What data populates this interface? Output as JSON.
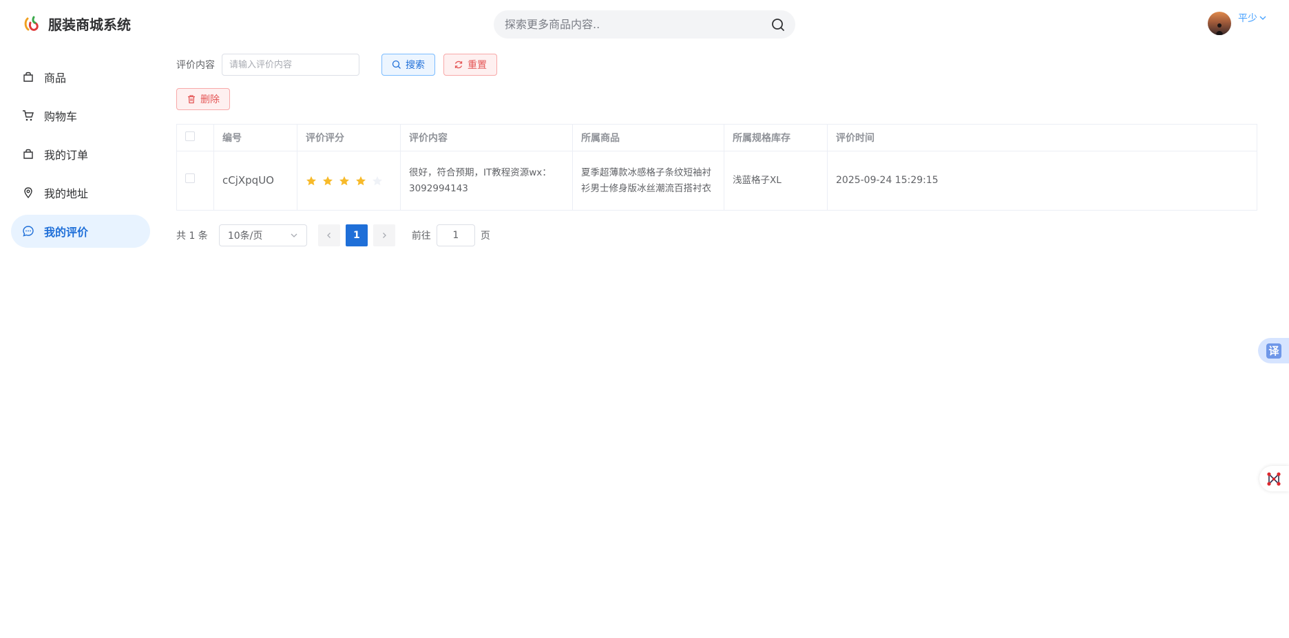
{
  "app": {
    "title": "服装商城系统"
  },
  "header": {
    "search": {
      "placeholder": "探索更多商品内容.."
    },
    "user": {
      "name": "平少"
    }
  },
  "sidebar": {
    "items": [
      {
        "label": "商品",
        "icon": "shopping-bag-icon",
        "active": false
      },
      {
        "label": "购物车",
        "icon": "shopping-cart-icon",
        "active": false
      },
      {
        "label": "我的订单",
        "icon": "order-bag-icon",
        "active": false
      },
      {
        "label": "我的地址",
        "icon": "location-pin-icon",
        "active": false
      },
      {
        "label": "我的评价",
        "icon": "chat-bubble-icon",
        "active": true
      }
    ]
  },
  "filter": {
    "label": "评价内容",
    "placeholder": "请输入评价内容",
    "search_label": "搜索",
    "reset_label": "重置",
    "delete_label": "删除"
  },
  "table": {
    "columns": [
      "编号",
      "评价评分",
      "评价内容",
      "所属商品",
      "所属规格库存",
      "评价时间"
    ],
    "rows": [
      {
        "id": "cCjXpqUO",
        "rating": 4,
        "rating_max": 5,
        "content": "很好，符合预期，IT教程资源wx：3092994143",
        "product": "夏季超薄款冰感格子条纹短袖衬衫男士修身版冰丝潮流百搭衬衣",
        "spec": "浅蓝格子XL",
        "time": "2025-09-24 15:29:15"
      }
    ]
  },
  "pagination": {
    "total_text": "共 1 条",
    "page_size": "10条/页",
    "current_page": "1",
    "goto_label": "前往",
    "goto_value": "1",
    "page_suffix": "页"
  },
  "widgets": {
    "translate_label": "译"
  },
  "colors": {
    "primary": "#1f6fd8",
    "danger": "#e45656",
    "star": "#f7ba2a",
    "star_empty": "#eff2f7",
    "active_bg": "#e8f3ff"
  }
}
